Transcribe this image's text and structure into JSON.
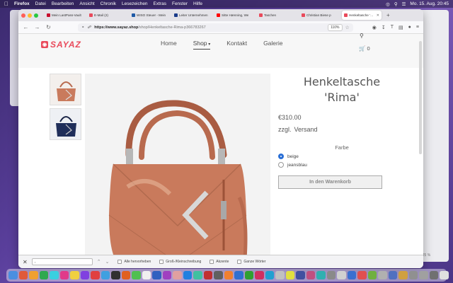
{
  "menubar": {
    "apple": "",
    "app": "Firefox",
    "items": [
      "Datei",
      "Bearbeiten",
      "Ansicht",
      "Chronik",
      "Lesezeichen",
      "Extras",
      "Fenster",
      "Hilfe"
    ],
    "clock": "Mo. 15. Aug.  20:45"
  },
  "tabs": [
    {
      "label": "Mein LastPass-Vault",
      "color": "#c8102e"
    },
    {
      "label": "E-Mail (2)",
      "color": "#e94a5b"
    },
    {
      "label": "WISO Steuer - Mein",
      "color": "#1f5aa6"
    },
    {
      "label": "Leiter Unternehmen",
      "color": "#1a3b8a"
    },
    {
      "label": "Sitte Hænning, We",
      "color": "#ff0000"
    },
    {
      "label": "Taschen",
      "color": "#e94a5b"
    },
    {
      "label": "Christian Biese p",
      "color": "#e94a5b"
    },
    {
      "label": "Henkeltasche 'Rima'",
      "color": "#e94a5b",
      "active": true
    }
  ],
  "browser": {
    "url_domain": "https://www.sayaz.shop",
    "url_path": "/shop/Henkeltasche-Rima-p366783267",
    "zoom": "110%"
  },
  "site": {
    "logo_text": "SAYAZ",
    "nav": [
      {
        "label": "Home"
      },
      {
        "label": "Shop",
        "current": true
      },
      {
        "label": "Kontakt"
      },
      {
        "label": "Galerie"
      }
    ],
    "cart_count": "0"
  },
  "product": {
    "title_line1": "Henkeltasche",
    "title_line2": "'Rima'",
    "price": "€310.00",
    "shipping_prefix": "zzgl.",
    "shipping_link": "Versand",
    "color_label": "Farbe",
    "options": [
      {
        "label": "beige",
        "checked": true
      },
      {
        "label": "jeansblau",
        "checked": false
      }
    ],
    "cart_button": "In den Warenkorb"
  },
  "findbar": {
    "query": ",",
    "options": [
      "Alle hervorheben",
      "Groß-/Kleinschreibung",
      "Akzente",
      "Ganze Wörter"
    ]
  },
  "background": {
    "right_window_pct": "125 %"
  },
  "colors": {
    "brand": "#e94a5b",
    "bag_main": "#c97a5c",
    "bag_blue": "#1f2e5a"
  }
}
